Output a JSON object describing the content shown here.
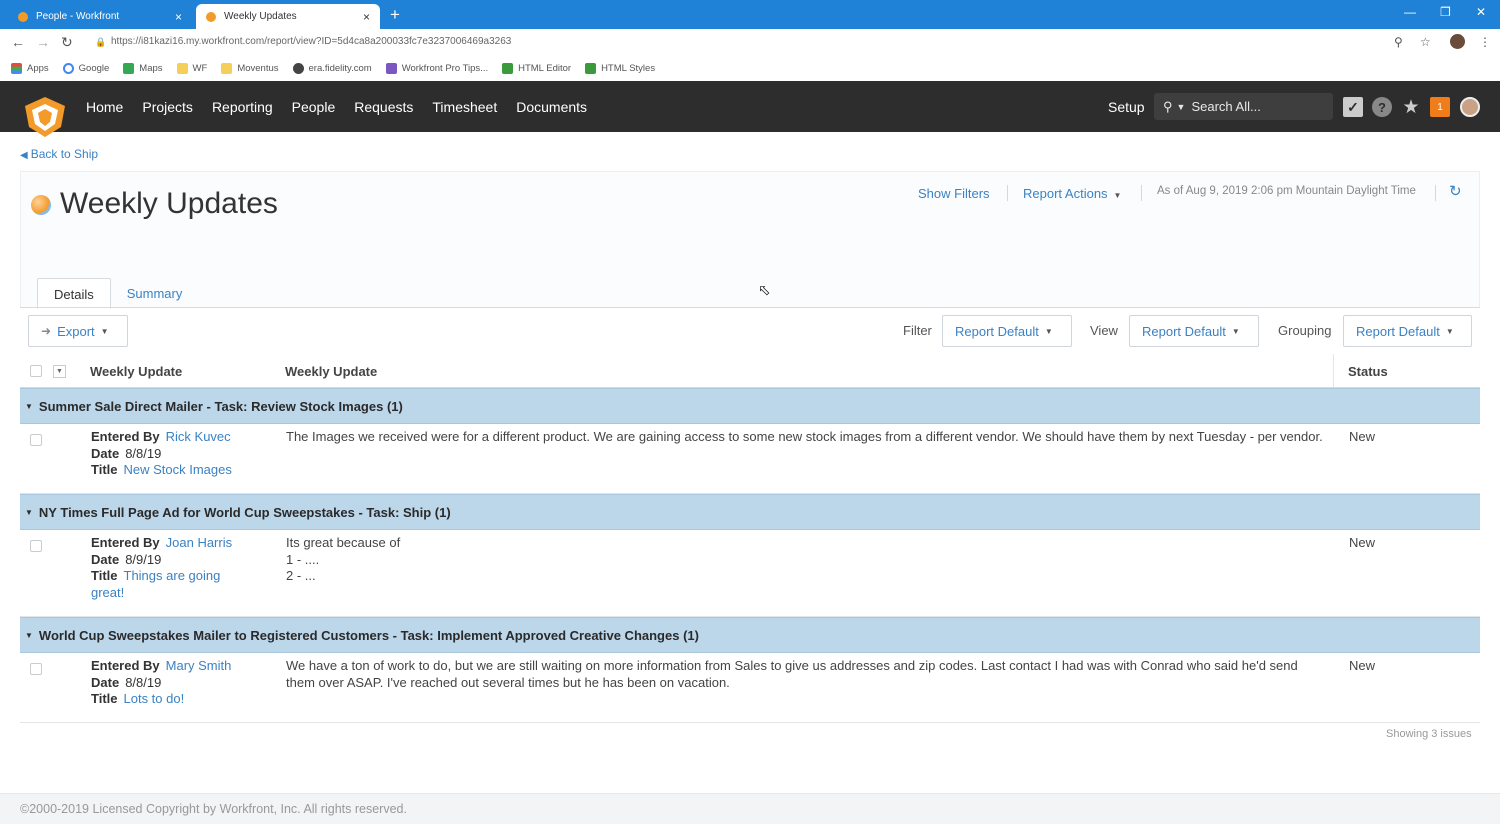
{
  "browser": {
    "tabs": [
      {
        "title": "People - Workfront",
        "close": "×"
      },
      {
        "title": "Weekly Updates",
        "close": "×"
      }
    ],
    "new_tab": "+",
    "url": "https://i81kazi16.my.workfront.com/report/view?ID=5d4ca8a200033fc7e3237006469a3263",
    "bookmarks": [
      "Apps",
      "Google",
      "Maps",
      "WF",
      "Moventus",
      "era.fidelity.com",
      "Workfront Pro Tips...",
      "HTML Editor",
      "HTML Styles"
    ]
  },
  "topnav": {
    "items": [
      "Home",
      "Projects",
      "Reporting",
      "People",
      "Requests",
      "Timesheet",
      "Documents"
    ],
    "setup": "Setup",
    "search_placeholder": "Search All...",
    "notification_count": "1",
    "help": "?"
  },
  "page": {
    "back_link": "Back to Ship",
    "title": "Weekly Updates",
    "show_filters": "Show Filters",
    "report_actions": "Report Actions",
    "as_of": "As of Aug 9, 2019 2:06 pm Mountain Daylight Time",
    "tabs": [
      "Details",
      "Summary"
    ]
  },
  "toolbar": {
    "export": "Export",
    "filter_label": "Filter",
    "filter_value": "Report Default",
    "view_label": "View",
    "view_value": "Report Default",
    "grouping_label": "Grouping",
    "grouping_value": "Report Default"
  },
  "table": {
    "columns": [
      "Weekly Update",
      "Weekly Update",
      "Status"
    ],
    "labels": {
      "entered_by": "Entered By",
      "date": "Date",
      "title": "Title"
    },
    "groups": [
      {
        "heading": "Summer Sale Direct Mailer - Task: Review Stock Images (1)",
        "entered_by": "Rick Kuvec",
        "date": "8/8/19",
        "title": "New Stock Images",
        "update": "The Images we received were for a different product. We are gaining access to some new stock images from a different vendor. We should have them by next Tuesday - per vendor.",
        "status": "New"
      },
      {
        "heading": "NY Times Full Page Ad for World Cup Sweepstakes - Task: Ship (1)",
        "entered_by": "Joan Harris",
        "date": "8/9/19",
        "title": "Things are going great!",
        "update_lines": [
          "Its great because of",
          "1 - ....",
          "2 - ..."
        ],
        "status": "New"
      },
      {
        "heading": "World Cup Sweepstakes Mailer to Registered Customers - Task: Implement Approved Creative Changes (1)",
        "entered_by": "Mary Smith",
        "date": "8/8/19",
        "title": "Lots to do!",
        "update": "We have a ton of work to do, but we are still waiting on more information from Sales to give us addresses and zip codes. Last contact I had was with Conrad who said he'd send them over ASAP. I've reached out several times but he has been on vacation.",
        "status": "New"
      }
    ],
    "showing": "Showing 3 issues"
  },
  "footer": {
    "copyright": "©2000-2019 Licensed Copyright by Workfront, Inc. All rights reserved."
  },
  "colors": {
    "link": "#3a82c4",
    "header_bg": "#2d2d2d",
    "group_bg": "#bdd7ea",
    "brand_orange": "#f39b2a"
  },
  "icons": [
    "star-icon",
    "zoom-icon",
    "refresh-icon",
    "checkmark-icon",
    "help-icon",
    "notification-icon",
    "search-icon",
    "export-icon",
    "lock-icon"
  ]
}
